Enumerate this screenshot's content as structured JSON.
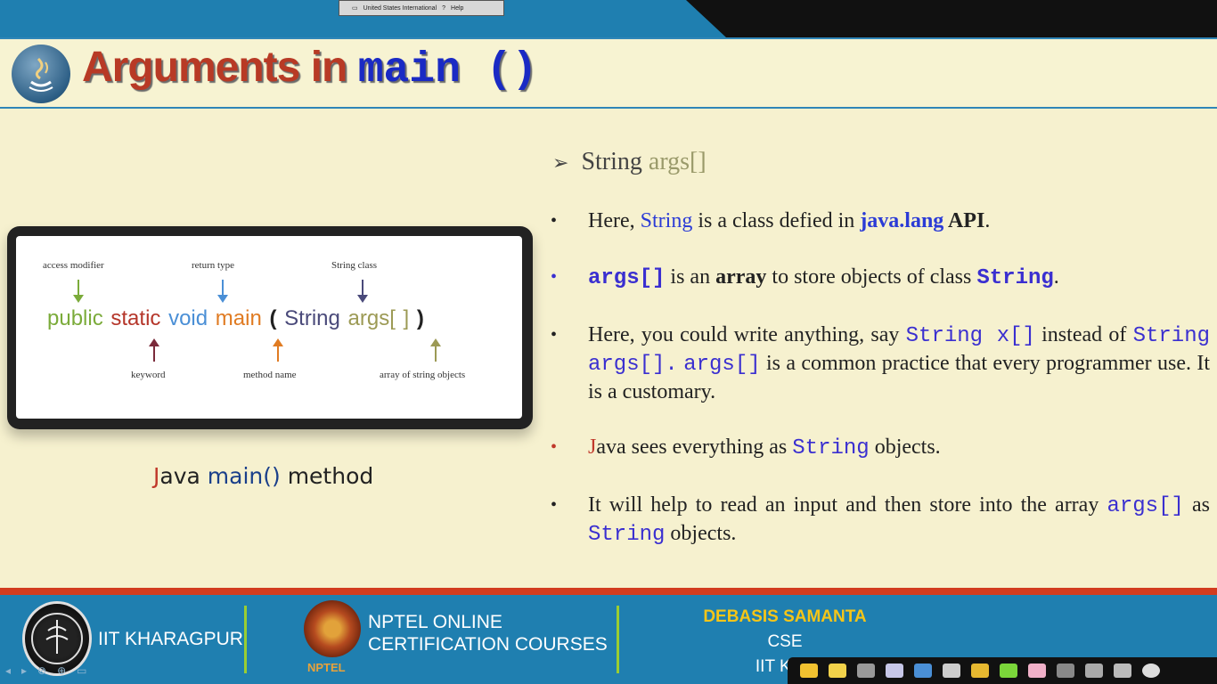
{
  "title": {
    "text": "Arguments in ",
    "code": "main ()"
  },
  "lang_bar": {
    "label": "United States International",
    "help": "Help"
  },
  "diagram": {
    "labels": {
      "access_modifier": "access modifier",
      "return_type": "return type",
      "string_class": "String class",
      "keyword": "keyword",
      "method_name": "method name",
      "array_objects": "array of string objects"
    },
    "sig": {
      "public": "public",
      "static": "static",
      "void": "void",
      "main": "main",
      "open": "(",
      "string": "String",
      "args": "args[ ]",
      "close": ")"
    },
    "colors": {
      "public": "#7bab3a",
      "static": "#b5362a",
      "void": "#4a8fd6",
      "main": "#e07b22",
      "string": "#4a4a7a",
      "args": "#9c9a55"
    }
  },
  "caption": {
    "j": "J",
    "ava": "ava ",
    "main": "main()",
    "method": " method"
  },
  "heading": {
    "arrow": "➢",
    "string": "String ",
    "args": "args[]"
  },
  "bullets": {
    "b1": {
      "p1": "Here, ",
      "s1": "String",
      "p2": " is a class defied in ",
      "s2": "java.lang",
      "p3": " API",
      "p4": "."
    },
    "b2": {
      "c1": "args[]",
      "p1": "  is an ",
      "s1": "array",
      "p2": " to store objects of class ",
      "c2": "String",
      "p3": "."
    },
    "b3": {
      "p1": "Here, you could write anything, say ",
      "c1": "String x[]",
      "p2": "  instead of ",
      "c2": "String args[].",
      "p3": " ",
      "c3": "args[]",
      "p4": "  is a common practice that every programmer use. It is a customary."
    },
    "b4": {
      "j": "J",
      "p1": "ava sees everything as ",
      "c1": "String",
      "p2": " objects."
    },
    "b5": {
      "p1": "It will help to read an input and then store into the array ",
      "c1": "args[]",
      "p2": "  as ",
      "c2": "String",
      "p3": " objects."
    }
  },
  "footer": {
    "iit": "IIT KHARAGPUR",
    "nptel_line1": "NPTEL ONLINE",
    "nptel_line2": "CERTIFICATION COURSES",
    "nptel_small": "NPTEL",
    "author_name": "DEBASIS SAMANTA",
    "author_dept": "CSE",
    "author_inst": "IIT KHA"
  }
}
